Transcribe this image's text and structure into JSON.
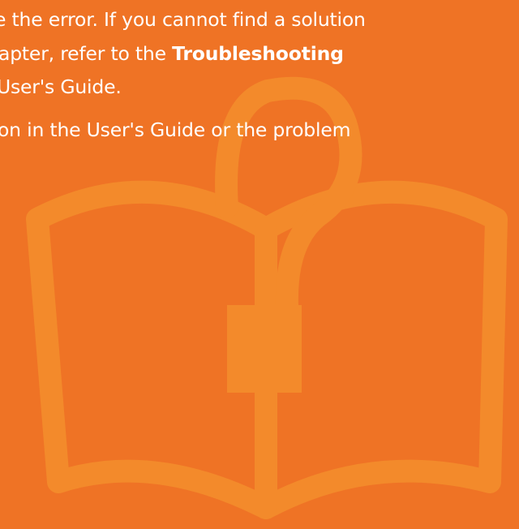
{
  "text": {
    "line1": "e the error. If you cannot find a solution",
    "line2_prefix": "apter, refer to the ",
    "line2_bold": "Troubleshooting",
    "line3": "User's Guide.",
    "line4": "on in the User's Guide or the problem"
  },
  "colors": {
    "background": "#ef7325",
    "watermark": "#f38a2b",
    "text": "#ffffff"
  },
  "icons": {
    "watermark": "book-question-icon"
  }
}
